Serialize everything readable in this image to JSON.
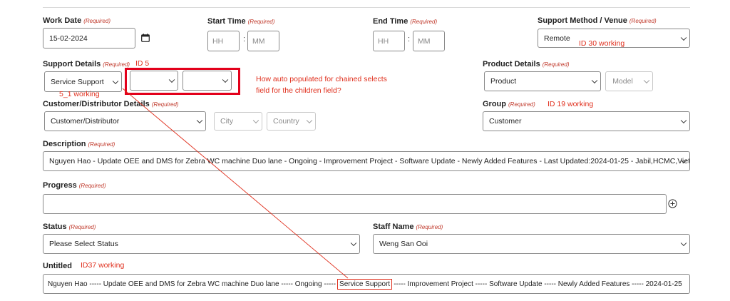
{
  "form": {
    "work_date": {
      "label": "Work Date",
      "req": "(Required)",
      "value": "15-02-2024"
    },
    "start_time": {
      "label": "Start Time",
      "req": "(Required)",
      "hh": "HH",
      "mm": "MM"
    },
    "end_time": {
      "label": "End Time",
      "req": "(Required)",
      "hh": "HH",
      "mm": "MM"
    },
    "support_method": {
      "label": "Support Method / Venue",
      "req": "(Required)",
      "value": "Remote"
    },
    "support_details": {
      "label": "Support Details",
      "req": "(Required)",
      "value": "Service Support"
    },
    "product_details": {
      "label": "Product Details",
      "req": "(Required)",
      "value": "Product",
      "model": "Model"
    },
    "customer": {
      "label": "Customer/Distributor Details",
      "req": "(Required)",
      "value": "Customer/Distributor",
      "city": "City",
      "country": "Country"
    },
    "group": {
      "label": "Group",
      "req": "(Required)",
      "value": "Customer"
    },
    "description": {
      "label": "Description",
      "req": "(Required)",
      "value": "Nguyen Hao - Update OEE and DMS for Zebra WC machine Duo lane - Ongoing - Improvement Project - Software Update - Newly Added Features - Last Updated:2024-01-25 - Jabil,HCMC,Viet Nam"
    },
    "progress": {
      "label": "Progress",
      "req": "(Required)",
      "value": ""
    },
    "status": {
      "label": "Status",
      "req": "(Required)",
      "value": "Please Select Status"
    },
    "staff_name": {
      "label": "Staff Name",
      "req": "(Required)",
      "value": "Weng San Ooi"
    },
    "untitled": {
      "label": "Untitled",
      "pre": "Nguyen Hao ----- Update OEE and DMS for Zebra WC machine Duo lane ----- Ongoing -----",
      "mid": "Service Support",
      "post": "----- Improvement Project ----- Software Update ----- Newly Added Features ----- 2024-01-25"
    },
    "colon": ":"
  },
  "annotations": {
    "id30": "ID 30 working",
    "id5": "ID 5",
    "question_line1": "How auto populated for chained selects",
    "question_line2": "field for the children field?",
    "id5_1": "5_1 working",
    "id19": "ID 19 working",
    "id37": "ID37 working",
    "color": "#e0301e"
  }
}
